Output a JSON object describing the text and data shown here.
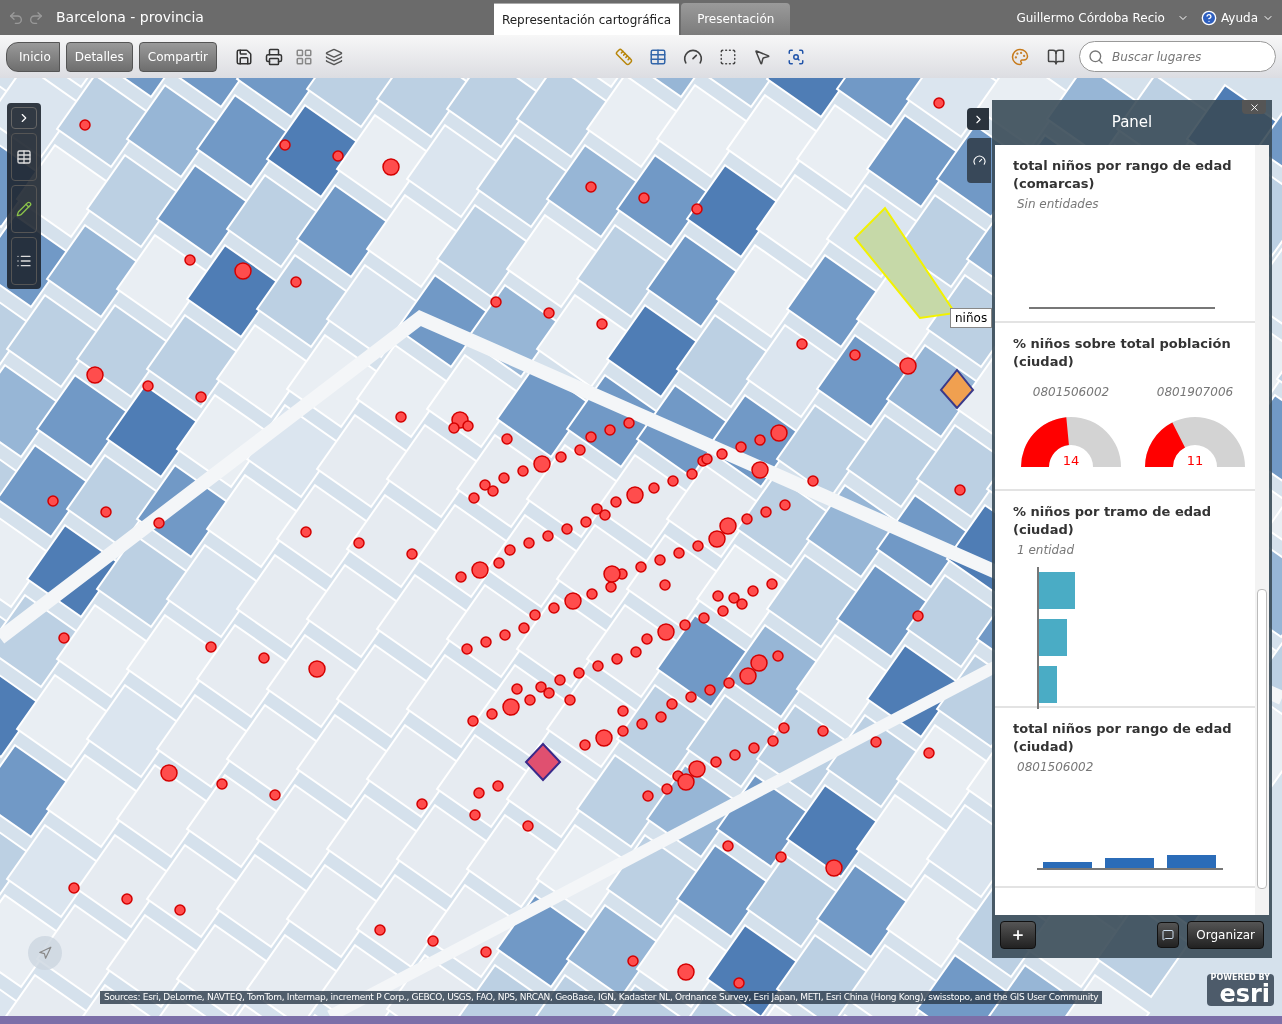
{
  "window": {
    "title": "Barcelona - provincia"
  },
  "tabs": [
    {
      "label": "Representación cartográfica",
      "selected": true
    },
    {
      "label": "Presentación",
      "selected": false
    }
  ],
  "user": {
    "name": "Guillermo Córdoba Recio"
  },
  "help": {
    "label": "Ayuda"
  },
  "toolbar": {
    "buttons": [
      "Inicio",
      "Detalles",
      "Compartir"
    ],
    "search": {
      "placeholder": "Buscar lugares"
    }
  },
  "map": {
    "tooltip": "niños",
    "attribution": "Sources: Esri, DeLorme, NAVTEQ, TomTom, Intermap, increment P Corp., GEBCO, USGS, FAO, NPS, NRCAN, GeoBase, IGN, Kadaster NL, Ordnance Survey, Esri Japan, METI, Esri China (Hong Kong), swisstopo, and the GIS User Community",
    "logo": {
      "caption": "POWERED BY",
      "name": "esri"
    }
  },
  "panel": {
    "title": "Panel",
    "widgets": [
      {
        "kind": "empty",
        "title": "total niños por rango de edad (comarcas)",
        "subtitle": "Sin entidades"
      },
      {
        "kind": "gauges",
        "title": "% niños sobre total población (ciudad)",
        "gauges": [
          {
            "label": "0801506002",
            "level": 0.47,
            "reading": "14"
          },
          {
            "label": "0801907006",
            "level": 0.35,
            "reading": "11"
          }
        ]
      },
      {
        "kind": "hbars",
        "title": "% niños por tramo de edad (ciudad)",
        "subtitle": "1 entidad"
      },
      {
        "kind": "vbars",
        "title": "total niños por rango de edad (ciudad)",
        "subtitle": "0801506002"
      }
    ],
    "organize": "Organizar"
  }
}
